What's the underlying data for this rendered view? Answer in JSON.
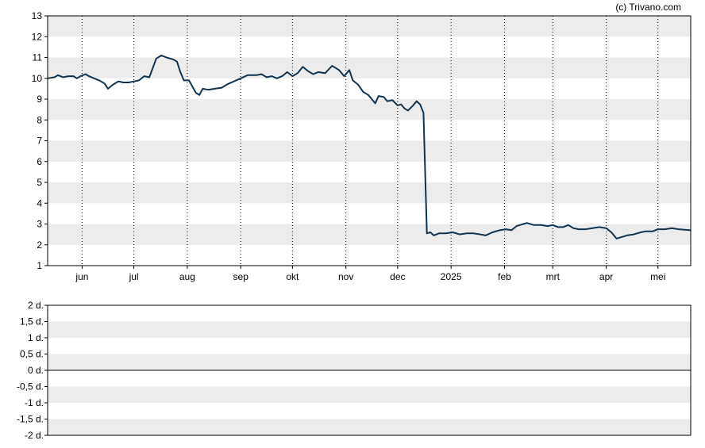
{
  "copyright": "(c) Trivano.com",
  "colors": {
    "line": "#0f3452",
    "band": "#ececec",
    "frame": "#000000",
    "gridline": "#000000"
  },
  "chart_data": [
    {
      "type": "line",
      "title": "",
      "xlabel": "",
      "ylabel": "",
      "ylim": [
        1,
        13
      ],
      "yticks": [
        "1",
        "2",
        "3",
        "4",
        "5",
        "6",
        "7",
        "8",
        "9",
        "10",
        "11",
        "12",
        "13"
      ],
      "xlim": [
        "2024-05-12",
        "2025-05-20"
      ],
      "xticks": [
        {
          "label": "jun",
          "date": "2024-06-01"
        },
        {
          "label": "jul",
          "date": "2024-07-01"
        },
        {
          "label": "aug",
          "date": "2024-08-01"
        },
        {
          "label": "sep",
          "date": "2024-09-01"
        },
        {
          "label": "okt",
          "date": "2024-10-01"
        },
        {
          "label": "nov",
          "date": "2024-11-01"
        },
        {
          "label": "dec",
          "date": "2024-12-01"
        },
        {
          "label": "2025",
          "date": "2025-01-01"
        },
        {
          "label": "feb",
          "date": "2025-02-01"
        },
        {
          "label": "mrt",
          "date": "2025-03-01"
        },
        {
          "label": "apr",
          "date": "2025-04-01"
        },
        {
          "label": "mei",
          "date": "2025-05-01"
        }
      ],
      "grid": true,
      "banded_background": true,
      "series": [
        {
          "points": [
            [
              "2024-05-12",
              10.0
            ],
            [
              "2024-05-16",
              10.05
            ],
            [
              "2024-05-18",
              10.15
            ],
            [
              "2024-05-21",
              10.05
            ],
            [
              "2024-05-24",
              10.1
            ],
            [
              "2024-05-27",
              10.1
            ],
            [
              "2024-05-29",
              10.0
            ],
            [
              "2024-05-31",
              10.1
            ],
            [
              "2024-06-03",
              10.2
            ],
            [
              "2024-06-05",
              10.1
            ],
            [
              "2024-06-08",
              10.0
            ],
            [
              "2024-06-11",
              9.9
            ],
            [
              "2024-06-14",
              9.75
            ],
            [
              "2024-06-16",
              9.5
            ],
            [
              "2024-06-19",
              9.7
            ],
            [
              "2024-06-22",
              9.85
            ],
            [
              "2024-06-25",
              9.8
            ],
            [
              "2024-06-28",
              9.8
            ],
            [
              "2024-07-01",
              9.85
            ],
            [
              "2024-07-04",
              9.9
            ],
            [
              "2024-07-07",
              10.1
            ],
            [
              "2024-07-10",
              10.05
            ],
            [
              "2024-07-12",
              10.5
            ],
            [
              "2024-07-14",
              10.95
            ],
            [
              "2024-07-17",
              11.1
            ],
            [
              "2024-07-20",
              11.0
            ],
            [
              "2024-07-24",
              10.9
            ],
            [
              "2024-07-26",
              10.8
            ],
            [
              "2024-07-28",
              10.3
            ],
            [
              "2024-07-30",
              9.9
            ],
            [
              "2024-08-02",
              9.9
            ],
            [
              "2024-08-04",
              9.6
            ],
            [
              "2024-08-06",
              9.3
            ],
            [
              "2024-08-08",
              9.2
            ],
            [
              "2024-08-10",
              9.5
            ],
            [
              "2024-08-13",
              9.45
            ],
            [
              "2024-08-17",
              9.5
            ],
            [
              "2024-08-21",
              9.55
            ],
            [
              "2024-08-24",
              9.7
            ],
            [
              "2024-08-28",
              9.85
            ],
            [
              "2024-09-01",
              10.0
            ],
            [
              "2024-09-05",
              10.15
            ],
            [
              "2024-09-10",
              10.15
            ],
            [
              "2024-09-13",
              10.2
            ],
            [
              "2024-09-16",
              10.05
            ],
            [
              "2024-09-19",
              10.1
            ],
            [
              "2024-09-22",
              10.0
            ],
            [
              "2024-09-25",
              10.1
            ],
            [
              "2024-09-28",
              10.3
            ],
            [
              "2024-10-01",
              10.1
            ],
            [
              "2024-10-04",
              10.25
            ],
            [
              "2024-10-07",
              10.55
            ],
            [
              "2024-10-10",
              10.35
            ],
            [
              "2024-10-13",
              10.2
            ],
            [
              "2024-10-16",
              10.3
            ],
            [
              "2024-10-20",
              10.25
            ],
            [
              "2024-10-24",
              10.6
            ],
            [
              "2024-10-28",
              10.4
            ],
            [
              "2024-10-31",
              10.1
            ],
            [
              "2024-11-03",
              10.4
            ],
            [
              "2024-11-05",
              9.9
            ],
            [
              "2024-11-08",
              9.7
            ],
            [
              "2024-11-11",
              9.35
            ],
            [
              "2024-11-14",
              9.2
            ],
            [
              "2024-11-16",
              9.0
            ],
            [
              "2024-11-18",
              8.8
            ],
            [
              "2024-11-20",
              9.15
            ],
            [
              "2024-11-23",
              9.1
            ],
            [
              "2024-11-25",
              8.9
            ],
            [
              "2024-11-28",
              8.95
            ],
            [
              "2024-12-01",
              8.7
            ],
            [
              "2024-12-03",
              8.75
            ],
            [
              "2024-12-05",
              8.55
            ],
            [
              "2024-12-07",
              8.45
            ],
            [
              "2024-12-10",
              8.7
            ],
            [
              "2024-12-12",
              8.9
            ],
            [
              "2024-12-14",
              8.75
            ],
            [
              "2024-12-16",
              8.35
            ],
            [
              "2024-12-18",
              2.55
            ],
            [
              "2024-12-20",
              2.6
            ],
            [
              "2024-12-22",
              2.45
            ],
            [
              "2024-12-25",
              2.55
            ],
            [
              "2024-12-29",
              2.55
            ],
            [
              "2025-01-02",
              2.6
            ],
            [
              "2025-01-06",
              2.5
            ],
            [
              "2025-01-10",
              2.55
            ],
            [
              "2025-01-14",
              2.55
            ],
            [
              "2025-01-18",
              2.5
            ],
            [
              "2025-01-21",
              2.45
            ],
            [
              "2025-01-25",
              2.6
            ],
            [
              "2025-01-29",
              2.7
            ],
            [
              "2025-02-02",
              2.75
            ],
            [
              "2025-02-05",
              2.7
            ],
            [
              "2025-02-08",
              2.9
            ],
            [
              "2025-02-12",
              3.0
            ],
            [
              "2025-02-14",
              3.05
            ],
            [
              "2025-02-18",
              2.95
            ],
            [
              "2025-02-22",
              2.95
            ],
            [
              "2025-02-26",
              2.9
            ],
            [
              "2025-03-01",
              2.95
            ],
            [
              "2025-03-04",
              2.85
            ],
            [
              "2025-03-07",
              2.85
            ],
            [
              "2025-03-10",
              2.95
            ],
            [
              "2025-03-13",
              2.8
            ],
            [
              "2025-03-16",
              2.75
            ],
            [
              "2025-03-20",
              2.75
            ],
            [
              "2025-03-24",
              2.8
            ],
            [
              "2025-03-28",
              2.85
            ],
            [
              "2025-04-01",
              2.8
            ],
            [
              "2025-04-04",
              2.6
            ],
            [
              "2025-04-07",
              2.3
            ],
            [
              "2025-04-09",
              2.35
            ],
            [
              "2025-04-13",
              2.45
            ],
            [
              "2025-04-17",
              2.5
            ],
            [
              "2025-04-21",
              2.6
            ],
            [
              "2025-04-24",
              2.65
            ],
            [
              "2025-04-28",
              2.65
            ],
            [
              "2025-05-01",
              2.75
            ],
            [
              "2025-05-05",
              2.75
            ],
            [
              "2025-05-09",
              2.8
            ],
            [
              "2025-05-13",
              2.75
            ],
            [
              "2025-05-20",
              2.7
            ]
          ]
        }
      ]
    },
    {
      "type": "line",
      "title": "",
      "xlabel": "",
      "ylabel": "",
      "ylim": [
        -2,
        2
      ],
      "yticks": [
        "2 d.",
        "1,5 d.",
        "1 d.",
        "0,5 d.",
        "0 d.",
        "-0,5 d.",
        "-1 d.",
        "-1,5 d.",
        "-2 d."
      ],
      "ytick_values": [
        2,
        1.5,
        1,
        0.5,
        0,
        -0.5,
        -1,
        -1.5,
        -2
      ],
      "zero_line": 0,
      "banded_background": true,
      "series": []
    }
  ]
}
